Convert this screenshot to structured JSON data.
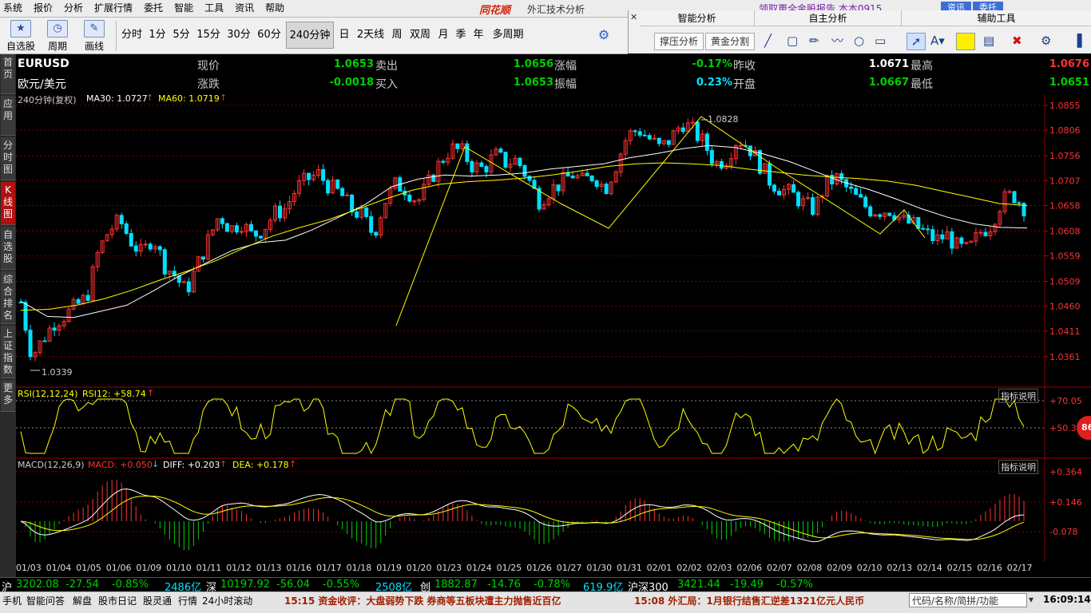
{
  "menu": [
    "系统",
    "报价",
    "分析",
    "扩展行情",
    "委托",
    "智能",
    "工具",
    "资讯",
    "帮助"
  ],
  "window": {
    "brand": "同花顺",
    "title": "外汇技术分析",
    "top_links": "领取更全金股报告   本本0915",
    "btn_news": "资讯",
    "btn_trade": "委托"
  },
  "toolbar": {
    "big_buttons": [
      {
        "label": "自选股",
        "icon": "star-icon"
      },
      {
        "label": "周期",
        "icon": "clock-icon"
      },
      {
        "label": "画线",
        "icon": "pen-icon"
      }
    ],
    "periods": [
      "分时",
      "1分",
      "5分",
      "15分",
      "30分",
      "60分",
      "240分钟",
      "日",
      "2天线",
      "周",
      "双周",
      "月",
      "季",
      "年",
      "多周期"
    ],
    "selected_period": "240分钟"
  },
  "right_panel": {
    "headers": [
      "智能分析",
      "自主分析",
      "辅助工具"
    ],
    "smart_buttons": [
      "撑压分析",
      "黄金分割"
    ]
  },
  "vtabs": [
    "首页",
    "应用",
    "分时图",
    "K线图",
    "自选股",
    "综合排名",
    "上证指数",
    "更多"
  ],
  "quote": {
    "symbol": "EURUSD",
    "name": "欧元/美元",
    "fields": [
      {
        "label": "现价",
        "value": "1.0653",
        "cls": "dn"
      },
      {
        "label": "卖出",
        "value": "1.0656",
        "cls": "dn"
      },
      {
        "label": "涨幅",
        "value": "-0.17%",
        "cls": "dn"
      },
      {
        "label": "昨收",
        "value": "1.0671",
        "cls": "wh"
      },
      {
        "label": "最高",
        "value": "1.0676",
        "cls": "up"
      },
      {
        "label": "涨跌",
        "value": "-0.0018",
        "cls": "dn"
      },
      {
        "label": "买入",
        "value": "1.0653",
        "cls": "dn"
      },
      {
        "label": "振幅",
        "value": "0.23%",
        "cls": "cy"
      },
      {
        "label": "开盘",
        "value": "1.0667",
        "cls": "dn"
      },
      {
        "label": "最低",
        "value": "1.0651",
        "cls": "dn"
      }
    ]
  },
  "main_legend": {
    "period": "240分钟(复权)",
    "ma30": "MA30: 1.0727",
    "ma60": "MA60: 1.0719"
  },
  "rsi_legend": {
    "name": "RSI(12,12,24)",
    "value": "RSI12: +58.74",
    "btn": "指标说明"
  },
  "macd_legend": {
    "name": "MACD(12,26,9)",
    "macd": "MACD: +0.050",
    "diff": "DIFF: +0.203",
    "dea": "DEA: +0.178",
    "btn": "指标说明"
  },
  "annotations": {
    "high": "1.0828",
    "low": "1.0339",
    "badge": "86"
  },
  "chart_data": {
    "type": "candlestick",
    "price_ylim": [
      1.0312,
      1.0855
    ],
    "price_ticks": [
      "1.0855",
      "1.0806",
      "1.0756",
      "1.0707",
      "1.0658",
      "1.0608",
      "1.0559",
      "1.0509",
      "1.0460",
      "1.0411",
      "1.0361"
    ],
    "rsi_ticks": [
      "+70.05",
      "+50.37"
    ],
    "macd_ticks": [
      "+0.364",
      "+0.146",
      "-0.078"
    ],
    "dates": [
      "01/03",
      "01/04",
      "01/05",
      "01/06",
      "01/09",
      "01/10",
      "01/11",
      "01/12",
      "01/13",
      "01/16",
      "01/17",
      "01/18",
      "01/19",
      "01/20",
      "01/23",
      "01/24",
      "01/25",
      "01/26",
      "01/27",
      "01/30",
      "01/31",
      "02/01",
      "02/02",
      "02/03",
      "02/06",
      "02/07",
      "02/08",
      "02/09",
      "02/10",
      "02/13",
      "02/14",
      "02/15",
      "02/16",
      "02/17"
    ],
    "close_path": [
      1.0468,
      1.0362,
      1.0395,
      1.0428,
      1.0442,
      1.046,
      1.0478,
      1.0565,
      1.061,
      1.0628,
      1.0588,
      1.0562,
      1.0598,
      1.0542,
      1.052,
      1.0488,
      1.054,
      1.059,
      1.064,
      1.0612,
      1.0625,
      1.0598,
      1.0612,
      1.0642,
      1.0652,
      1.0692,
      1.071,
      1.072,
      1.0695,
      1.0682,
      1.065,
      1.0638,
      1.06,
      1.0665,
      1.07,
      1.069,
      1.0665,
      1.0702,
      1.0742,
      1.077,
      1.0765,
      1.0735,
      1.073,
      1.0758,
      1.0742,
      1.0748,
      1.0712,
      1.0668,
      1.0688,
      1.0702,
      1.072,
      1.0705,
      1.0718,
      1.069,
      1.0738,
      1.0795,
      1.0808,
      1.079,
      1.077,
      1.079,
      1.0822,
      1.0805,
      1.078,
      1.074,
      1.075,
      1.079,
      1.0775,
      1.074,
      1.0705,
      1.069,
      1.068,
      1.0662,
      1.065,
      1.07,
      1.0712,
      1.069,
      1.0668,
      1.065,
      1.0648,
      1.065,
      1.0628,
      1.062,
      1.0605,
      1.059,
      1.06,
      1.0575,
      1.057,
      1.0605,
      1.062,
      1.0668,
      1.068,
      1.0655
    ],
    "ma_short_path": [
      1.047,
      1.044,
      1.0438,
      1.045,
      1.0462,
      1.049,
      1.052,
      1.0545,
      1.057,
      1.0585,
      1.059,
      1.061,
      1.0635,
      1.066,
      1.0695,
      1.071,
      1.0718,
      1.0716,
      1.0718,
      1.0722,
      1.073,
      1.0735,
      1.074,
      1.0752,
      1.076,
      1.077,
      1.0776,
      1.0772,
      1.076,
      1.0745,
      1.0725,
      1.0705,
      1.069,
      1.0672,
      1.0652,
      1.0635,
      1.0622,
      1.0615,
      1.0614
    ],
    "ma_long_path": [
      1.0452,
      1.0454,
      1.0462,
      1.0475,
      1.0492,
      1.0512,
      1.053,
      1.055,
      1.0575,
      1.0598,
      1.0615,
      1.063,
      1.065,
      1.067,
      1.0688,
      1.07,
      1.0705,
      1.0708,
      1.0712,
      1.0718,
      1.0726,
      1.0735,
      1.074,
      1.0742,
      1.074,
      1.0737,
      1.073,
      1.0724,
      1.0718,
      1.0714,
      1.0711,
      1.0706,
      1.0698,
      1.0686,
      1.0674,
      1.0662,
      1.0658
    ]
  },
  "bottom_index": [
    {
      "label": "沪",
      "value": "",
      "cls": "wh"
    },
    {
      "label": "",
      "value": "3202.08",
      "cls": "dn"
    },
    {
      "label": "",
      "value": "-27.54",
      "cls": "dn"
    },
    {
      "label": "",
      "value": "-0.85%",
      "cls": "dn"
    },
    {
      "label": "",
      "value": "2486亿",
      "cls": "cy"
    },
    {
      "label": "深",
      "value": "",
      "cls": "wh"
    },
    {
      "label": "",
      "value": "10197.92",
      "cls": "dn"
    },
    {
      "label": "",
      "value": "-56.04",
      "cls": "dn"
    },
    {
      "label": "",
      "value": "-0.55%",
      "cls": "dn"
    },
    {
      "label": "",
      "value": "2508亿",
      "cls": "cy"
    },
    {
      "label": "创",
      "value": "",
      "cls": "wh"
    },
    {
      "label": "",
      "value": "1882.87",
      "cls": "dn"
    },
    {
      "label": "",
      "value": "-14.76",
      "cls": "dn"
    },
    {
      "label": "",
      "value": "-0.78%",
      "cls": "dn"
    },
    {
      "label": "",
      "value": "619.9亿",
      "cls": "cy"
    },
    {
      "label": "沪深300",
      "value": "",
      "cls": "wh"
    },
    {
      "label": "",
      "value": "3421.44",
      "cls": "dn"
    },
    {
      "label": "",
      "value": "-19.49",
      "cls": "dn"
    },
    {
      "label": "",
      "value": "-0.57%",
      "cls": "dn"
    }
  ],
  "status": {
    "items": [
      "手机",
      "智能问答",
      "解盘",
      "股市日记",
      "股灵通",
      "行情",
      "24小时滚动"
    ],
    "news1": "15:15 资金收评：大盘弱势下跌 券商等五板块遭主力抛售近百亿",
    "news2": "15:08 外汇局：1月银行结售汇逆差1321亿元人民币",
    "search_placeholder": "代码/名称/简拼/功能",
    "clock": "16:09:14"
  },
  "colors": {
    "up": "#ff3232",
    "down": "#00e0ff",
    "ma30": "#ffffff",
    "ma60": "#ffff00",
    "grid": "#7a0000"
  }
}
